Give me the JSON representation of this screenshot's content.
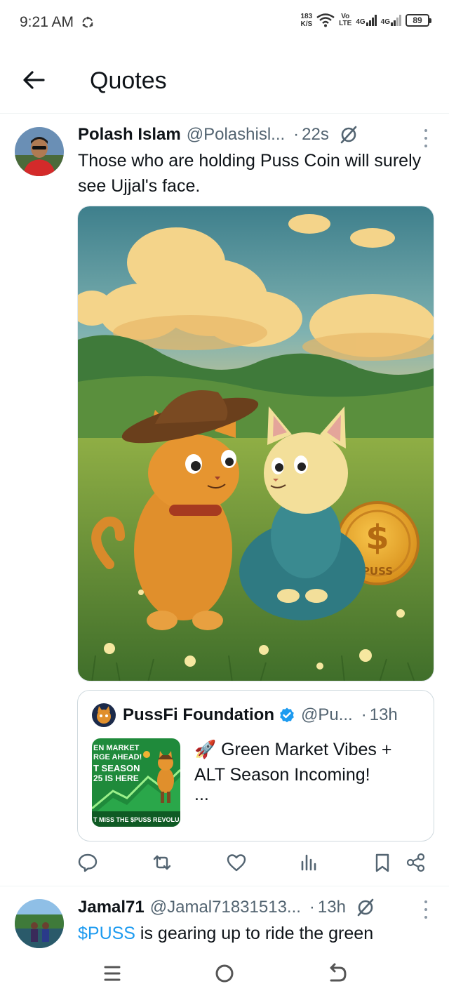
{
  "status_bar": {
    "time": "9:21 AM",
    "speed_value": "183",
    "speed_unit": "K/S",
    "volte_top": "Vo",
    "volte_bottom": "LTE",
    "net1": "4G",
    "net2": "4G",
    "battery": "89"
  },
  "header": {
    "back_icon": "arrow-left-icon",
    "title": "Quotes"
  },
  "tweets": [
    {
      "name": "Polash Islam",
      "handle": "@Polashisl...",
      "time": "22s",
      "text": "Those who are holding Puss Coin will surely see Ujjal's face.",
      "media": {
        "coin_label": "PUSS",
        "coin_symbol": "$"
      },
      "quote": {
        "name": "PussFi Foundation",
        "handle": "@Pu...",
        "time": "13h",
        "text": "🚀 Green Market Vibes + ALT Season Incoming!",
        "ellipsis": "...",
        "thumb_line1": "EN MARKET",
        "thumb_line2": "RGE AHEAD!",
        "thumb_line3": "T SEASON",
        "thumb_line4": "25 IS HERE",
        "thumb_footer": "T MISS THE $PUSS REVOLU"
      },
      "actions": [
        "reply-icon",
        "retweet-icon",
        "like-icon",
        "views-icon",
        "bookmark-icon",
        "share-icon"
      ]
    },
    {
      "name": "Jamal71",
      "handle": "@Jamal71831513...",
      "time": "13h",
      "cashtag": "$PUSS",
      "text_rest": " is gearing up to ride the green"
    }
  ],
  "nav_bar": {
    "buttons": [
      "recents-icon",
      "home-icon",
      "back-icon"
    ]
  },
  "colors": {
    "accent": "#1d9bf0",
    "text": "#0f1419",
    "muted": "#536471",
    "verified": "#1d9bf0",
    "thumb_green": "#1f8a3b"
  }
}
